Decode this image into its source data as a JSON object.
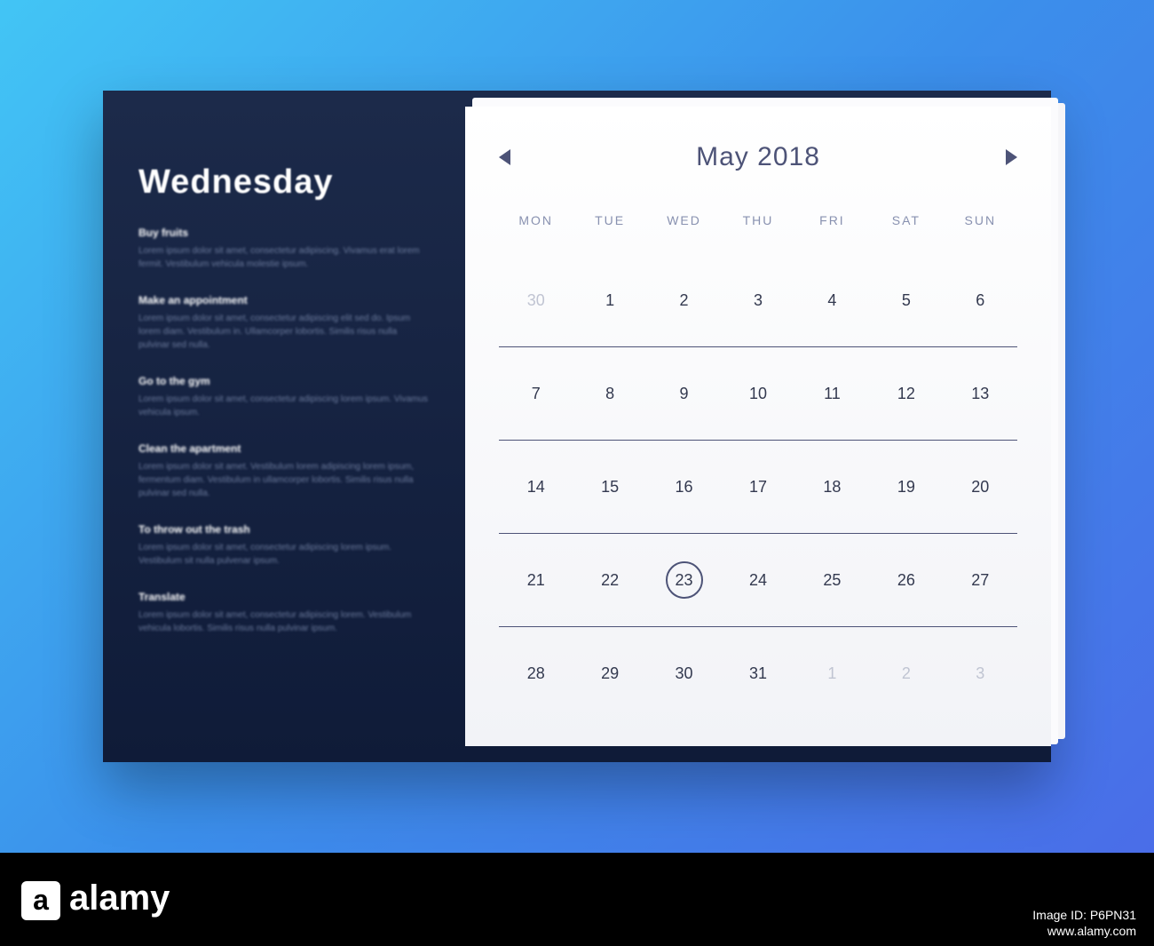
{
  "sidebar": {
    "day": "Wednesday",
    "events": [
      {
        "title": "Buy fruits",
        "desc": "Lorem ipsum dolor sit amet, consectetur adipiscing. Vivamus erat lorem fermit. Vestibulum vehicula molestie ipsum."
      },
      {
        "title": "Make an appointment",
        "desc": "Lorem ipsum dolor sit amet, consectetur adipiscing elit sed do. Ipsum lorem diam. Vestibulum in. Ullamcorper lobortis. Similis risus nulla pulvinar sed nulla."
      },
      {
        "title": "Go to the gym",
        "desc": "Lorem ipsum dolor sit amet, consectetur adipiscing lorem ipsum. Vivamus vehicula ipsum."
      },
      {
        "title": "Clean the apartment",
        "desc": "Lorem ipsum dolor sit amet. Vestibulum lorem adipiscing lorem ipsum, fermentum diam. Vestibulum in ullamcorper lobortis. Similis risus nulla pulvinar sed nulla."
      },
      {
        "title": "To throw out the trash",
        "desc": "Lorem ipsum dolor sit amet, consectetur adipiscing lorem ipsum. Vestibulum sit nulla pulvenar ipsum."
      },
      {
        "title": "Translate",
        "desc": "Lorem ipsum dolor sit amet, consectetur adipiscing lorem. Vestibulum vehicula lobortis. Similis risus nulla pulvinar ipsum."
      }
    ]
  },
  "calendar": {
    "month_title": "May 2018",
    "weekdays": [
      "MON",
      "TUE",
      "WED",
      "THU",
      "FRI",
      "SAT",
      "SUN"
    ],
    "weeks": [
      [
        {
          "n": "30",
          "other": true
        },
        {
          "n": "1"
        },
        {
          "n": "2"
        },
        {
          "n": "3"
        },
        {
          "n": "4"
        },
        {
          "n": "5"
        },
        {
          "n": "6"
        }
      ],
      [
        {
          "n": "7"
        },
        {
          "n": "8"
        },
        {
          "n": "9"
        },
        {
          "n": "10"
        },
        {
          "n": "11"
        },
        {
          "n": "12"
        },
        {
          "n": "13"
        }
      ],
      [
        {
          "n": "14"
        },
        {
          "n": "15"
        },
        {
          "n": "16"
        },
        {
          "n": "17"
        },
        {
          "n": "18"
        },
        {
          "n": "19"
        },
        {
          "n": "20"
        }
      ],
      [
        {
          "n": "21"
        },
        {
          "n": "22"
        },
        {
          "n": "23",
          "selected": true
        },
        {
          "n": "24"
        },
        {
          "n": "25"
        },
        {
          "n": "26"
        },
        {
          "n": "27"
        }
      ],
      [
        {
          "n": "28"
        },
        {
          "n": "29"
        },
        {
          "n": "30"
        },
        {
          "n": "31"
        },
        {
          "n": "1",
          "other": true
        },
        {
          "n": "2",
          "other": true
        },
        {
          "n": "3",
          "other": true
        }
      ]
    ]
  },
  "watermark": "alamy",
  "footer": {
    "logo_a": "a",
    "logo_text": "alamy",
    "id": "Image ID: P6PN31",
    "url": "www.alamy.com"
  }
}
